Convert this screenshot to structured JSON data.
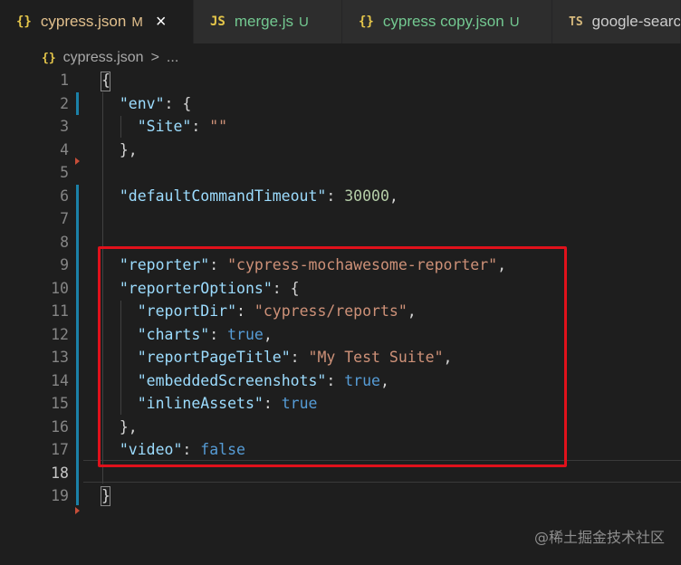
{
  "tabs": [
    {
      "icon": "{}",
      "name": "cypress.json",
      "badge": "M",
      "close": "×"
    },
    {
      "icon": "JS",
      "name": "merge.js",
      "badge": "U"
    },
    {
      "icon": "{}",
      "name": "cypress copy.json",
      "badge": "U"
    },
    {
      "icon": "TS",
      "name": "google-searc"
    }
  ],
  "breadcrumb": {
    "icon": "{}",
    "file": "cypress.json",
    "sep": ">",
    "more": "..."
  },
  "lines": [
    {
      "num": "1",
      "tokens": [
        [
          "p",
          "{"
        ]
      ]
    },
    {
      "num": "2",
      "tokens": [
        [
          "p",
          "  "
        ],
        [
          "k",
          "\"env\""
        ],
        [
          "p",
          ": {"
        ]
      ]
    },
    {
      "num": "3",
      "tokens": [
        [
          "p",
          "    "
        ],
        [
          "k",
          "\"Site\""
        ],
        [
          "p",
          ": "
        ],
        [
          "s",
          "\"\""
        ]
      ]
    },
    {
      "num": "4",
      "tokens": [
        [
          "p",
          "  },"
        ]
      ]
    },
    {
      "num": "5",
      "tokens": []
    },
    {
      "num": "6",
      "tokens": [
        [
          "p",
          "  "
        ],
        [
          "k",
          "\"defaultCommandTimeout\""
        ],
        [
          "p",
          ": "
        ],
        [
          "n",
          "30000"
        ],
        [
          "p",
          ","
        ]
      ]
    },
    {
      "num": "7",
      "tokens": []
    },
    {
      "num": "8",
      "tokens": []
    },
    {
      "num": "9",
      "tokens": [
        [
          "p",
          "  "
        ],
        [
          "k",
          "\"reporter\""
        ],
        [
          "p",
          ": "
        ],
        [
          "s",
          "\"cypress-mochawesome-reporter\""
        ],
        [
          "p",
          ","
        ]
      ]
    },
    {
      "num": "10",
      "tokens": [
        [
          "p",
          "  "
        ],
        [
          "k",
          "\"reporterOptions\""
        ],
        [
          "p",
          ": {"
        ]
      ]
    },
    {
      "num": "11",
      "tokens": [
        [
          "p",
          "    "
        ],
        [
          "k",
          "\"reportDir\""
        ],
        [
          "p",
          ": "
        ],
        [
          "s",
          "\"cypress/reports\""
        ],
        [
          "p",
          ","
        ]
      ]
    },
    {
      "num": "12",
      "tokens": [
        [
          "p",
          "    "
        ],
        [
          "k",
          "\"charts\""
        ],
        [
          "p",
          ": "
        ],
        [
          "b",
          "true"
        ],
        [
          "p",
          ","
        ]
      ]
    },
    {
      "num": "13",
      "tokens": [
        [
          "p",
          "    "
        ],
        [
          "k",
          "\"reportPageTitle\""
        ],
        [
          "p",
          ": "
        ],
        [
          "s",
          "\"My Test Suite\""
        ],
        [
          "p",
          ","
        ]
      ]
    },
    {
      "num": "14",
      "tokens": [
        [
          "p",
          "    "
        ],
        [
          "k",
          "\"embeddedScreenshots\""
        ],
        [
          "p",
          ": "
        ],
        [
          "b",
          "true"
        ],
        [
          "p",
          ","
        ]
      ]
    },
    {
      "num": "15",
      "tokens": [
        [
          "p",
          "    "
        ],
        [
          "k",
          "\"inlineAssets\""
        ],
        [
          "p",
          ": "
        ],
        [
          "b",
          "true"
        ]
      ]
    },
    {
      "num": "16",
      "tokens": [
        [
          "p",
          "  },"
        ]
      ]
    },
    {
      "num": "17",
      "tokens": [
        [
          "p",
          "  "
        ],
        [
          "k",
          "\"video\""
        ],
        [
          "p",
          ": "
        ],
        [
          "b",
          "false"
        ]
      ]
    },
    {
      "num": "18",
      "tokens": [],
      "current": true
    },
    {
      "num": "19",
      "tokens": [
        [
          "p",
          "}"
        ]
      ]
    }
  ],
  "watermark": "@稀土掘金技术社区",
  "colors": {
    "highlight": "#e0111b",
    "key": "#9cdcfe",
    "string": "#ce9178",
    "number": "#b5cea8",
    "boolean": "#569cd6"
  }
}
